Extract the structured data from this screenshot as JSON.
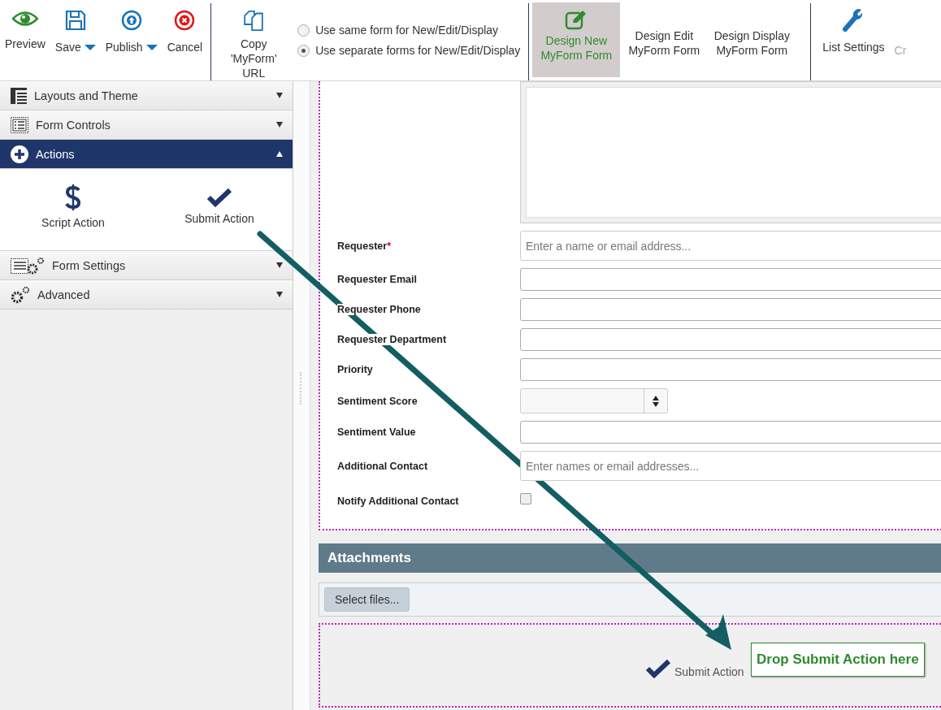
{
  "toolbar": {
    "file_buttons": [
      {
        "label": "Preview",
        "dropdown": false
      },
      {
        "label": "Save",
        "dropdown": true
      },
      {
        "label": "Publish",
        "dropdown": true
      },
      {
        "label": "Cancel",
        "dropdown": false
      }
    ],
    "copy_button": {
      "label": "Copy 'MyForm' URL"
    },
    "form_modes": [
      {
        "label": "Use same form for New/Edit/Display",
        "selected": false
      },
      {
        "label": "Use separate forms for New/Edit/Display",
        "selected": true
      }
    ],
    "design_tabs": [
      {
        "label": "Design New MyForm Form",
        "selected": true
      },
      {
        "label": "Design Edit MyForm Form",
        "selected": false
      },
      {
        "label": "Design Display MyForm Form",
        "selected": false
      }
    ],
    "list_settings": {
      "label": "List Settings"
    },
    "cut_item": {
      "label": "Cr"
    }
  },
  "sidebar": {
    "sections": [
      {
        "label": "Layouts and Theme",
        "expanded": false
      },
      {
        "label": "Form Controls",
        "expanded": false
      },
      {
        "label": "Actions",
        "expanded": true,
        "items": [
          {
            "label": "Script Action"
          },
          {
            "label": "Submit Action"
          }
        ]
      },
      {
        "label": "Form Settings",
        "expanded": false
      },
      {
        "label": "Advanced",
        "expanded": false
      }
    ]
  },
  "form": {
    "fields": [
      {
        "label": "Requester",
        "required_mark": "*",
        "kind": "people",
        "placeholder": "Enter a name or email address..."
      },
      {
        "label": "Requester Email",
        "kind": "text"
      },
      {
        "label": "Requester Phone",
        "kind": "text"
      },
      {
        "label": "Requester Department",
        "kind": "text"
      },
      {
        "label": "Priority",
        "kind": "text"
      },
      {
        "label": "Sentiment Score",
        "kind": "number"
      },
      {
        "label": "Sentiment Value",
        "kind": "text"
      },
      {
        "label": "Additional Contact",
        "kind": "people",
        "placeholder": "Enter names or email addresses..."
      },
      {
        "label": "Notify Additional Contact",
        "kind": "checkbox",
        "checked": false
      }
    ]
  },
  "attachments": {
    "title": "Attachments",
    "button": "Select files..."
  },
  "drop_zone": {
    "item": {
      "label": "Submit Action"
    },
    "tooltip": "Drop Submit Action here"
  }
}
